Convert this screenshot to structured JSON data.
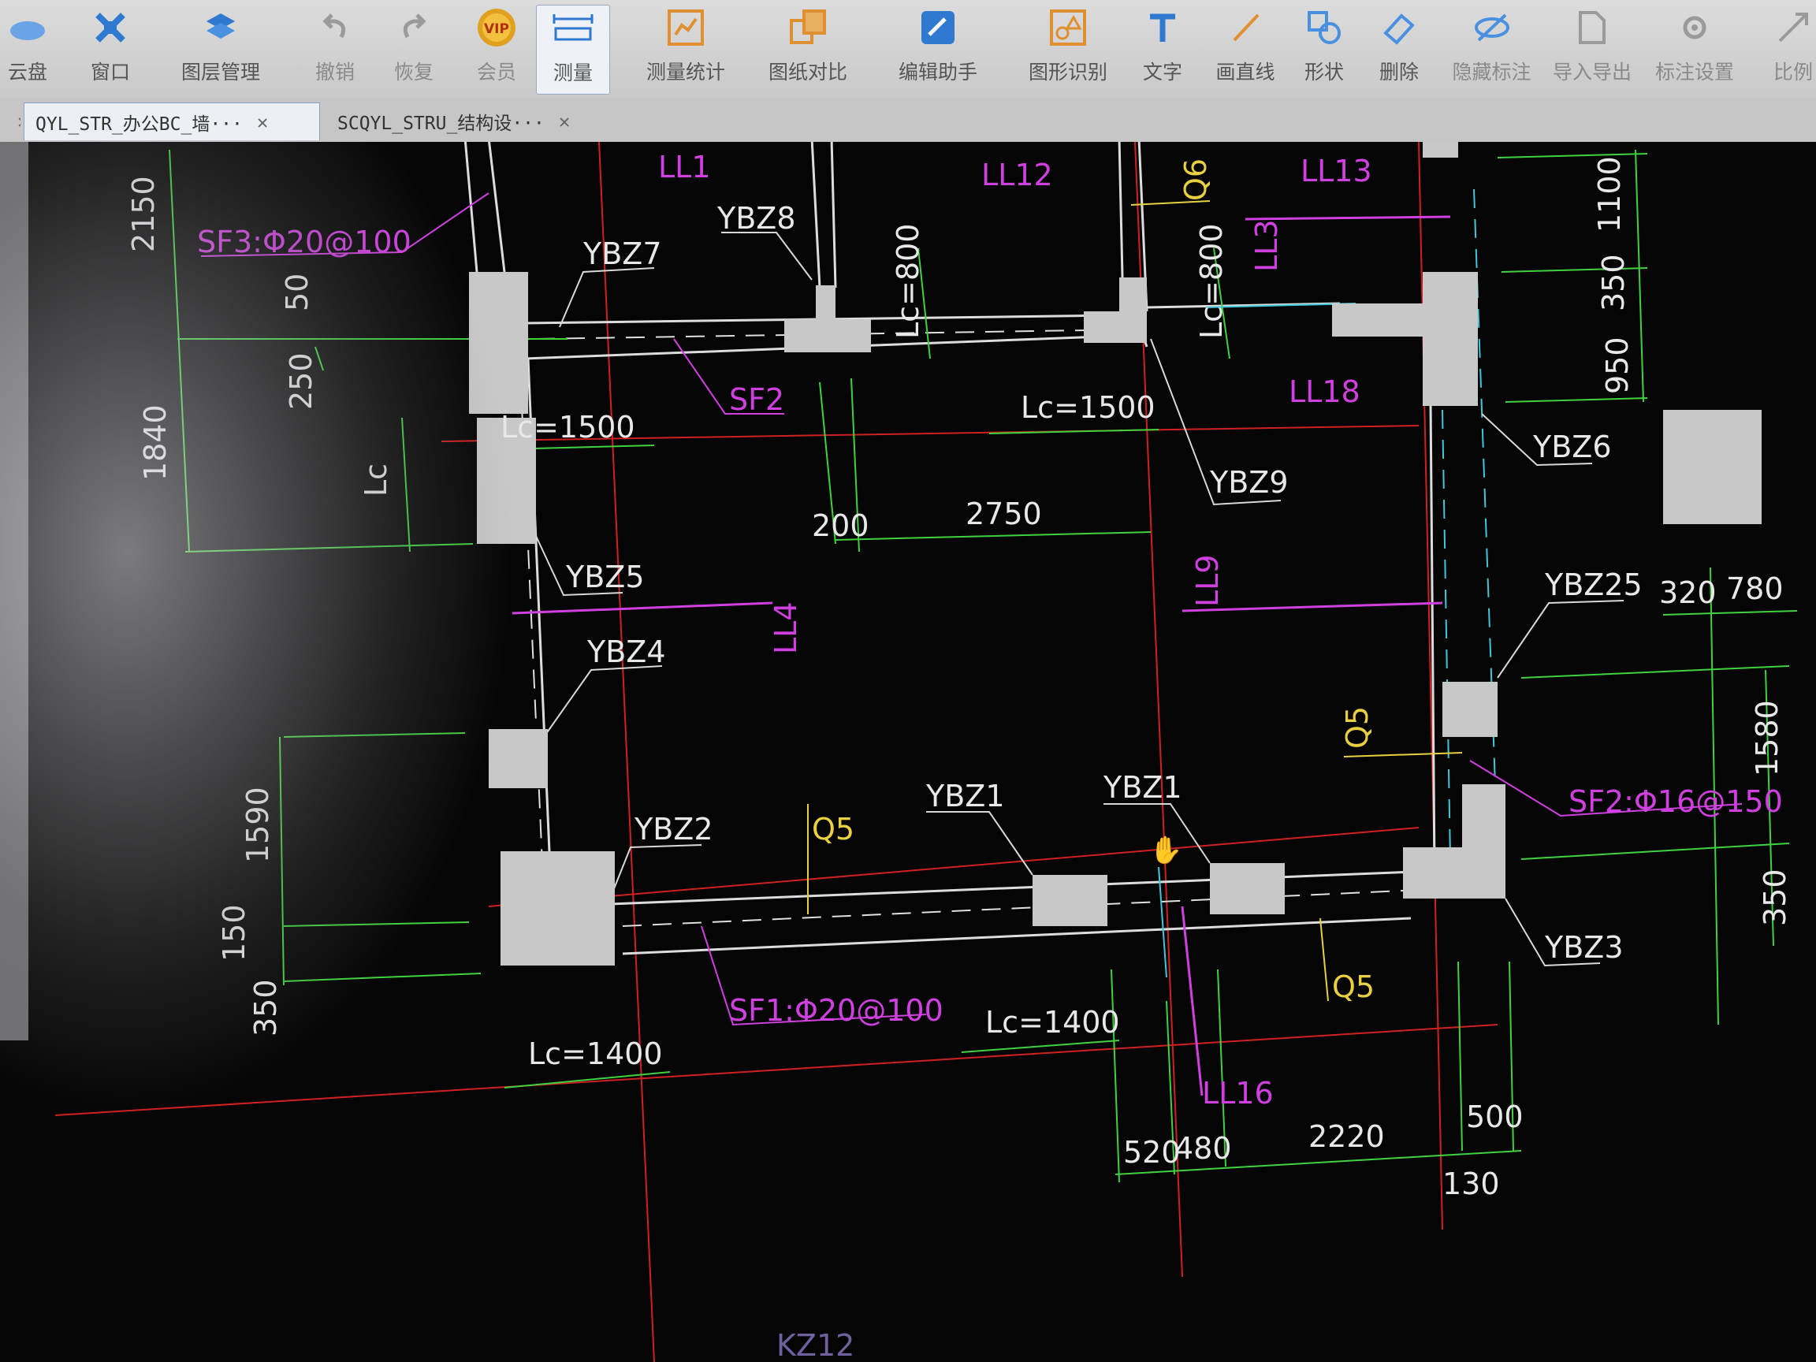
{
  "toolbar": {
    "items": [
      {
        "label": "云盘",
        "icon": "cloud-icon"
      },
      {
        "label": "窗口",
        "icon": "window-icon"
      },
      {
        "label": "图层管理",
        "icon": "layers-icon"
      },
      {
        "label": "撤销",
        "icon": "undo-icon"
      },
      {
        "label": "恢复",
        "icon": "redo-icon"
      },
      {
        "label": "会员",
        "icon": "vip-icon",
        "badge": "VIP"
      },
      {
        "label": "测量",
        "icon": "ruler-icon"
      },
      {
        "label": "测量统计",
        "icon": "measure-stats-icon"
      },
      {
        "label": "图纸对比",
        "icon": "compare-icon"
      },
      {
        "label": "编辑助手",
        "icon": "edit-assistant-icon"
      },
      {
        "label": "图形识别",
        "icon": "shape-recognition-icon"
      },
      {
        "label": "文字",
        "icon": "text-icon"
      },
      {
        "label": "画直线",
        "icon": "line-icon"
      },
      {
        "label": "形状",
        "icon": "shape-icon"
      },
      {
        "label": "删除",
        "icon": "eraser-icon"
      },
      {
        "label": "隐藏标注",
        "icon": "hide-annotation-icon"
      },
      {
        "label": "导入导出",
        "icon": "import-export-icon"
      },
      {
        "label": "标注设置",
        "icon": "annotation-settings-icon"
      },
      {
        "label": "比例",
        "icon": "scale-icon"
      }
    ]
  },
  "tabs": [
    {
      "label": "QYL_STR_办公BC_墙···",
      "close": "✕"
    },
    {
      "label": "SCQYL_STRU_结构设···",
      "close": "✕"
    }
  ],
  "drawing": {
    "columns": [
      "YBZ7",
      "YBZ8",
      "YBZ9",
      "YBZ6",
      "YBZ5",
      "YBZ4",
      "YBZ25",
      "YBZ2",
      "YBZ1",
      "YBZ1",
      "YBZ3"
    ],
    "beams": [
      "LL1",
      "LL12",
      "LL13",
      "LL3",
      "LL18",
      "LL4",
      "LL9",
      "LL16"
    ],
    "walls": [
      "Q6",
      "Q5",
      "Q5",
      "Q5"
    ],
    "rebar_notes": [
      "SF3:Φ20@100",
      "SF2",
      "SF1:Φ20@100",
      "SF2:Φ16@150"
    ],
    "lc_labels": [
      "Lc=800",
      "Lc=800",
      "Lc=1500",
      "Lc=1500",
      "Lc",
      "Lc=1400",
      "Lc=1400"
    ],
    "dims_left": [
      "2150",
      "50",
      "250",
      "1840",
      "1590",
      "150",
      "350"
    ],
    "dims_mid": [
      "200",
      "2750"
    ],
    "dims_bottom": [
      "520",
      "480",
      "2220",
      "500",
      "130"
    ],
    "dims_right": [
      "1100",
      "350",
      "950",
      "320",
      "780",
      "1580",
      "350"
    ],
    "partial": [
      "KZ12"
    ]
  },
  "colors": {
    "wall": "#c8c8c8",
    "text_white": "#e8e8e8",
    "magenta": "#d040e0",
    "yellow": "#e8d040",
    "green": "#3fd23f",
    "red": "#d02020",
    "cyan": "#40c8d8"
  }
}
